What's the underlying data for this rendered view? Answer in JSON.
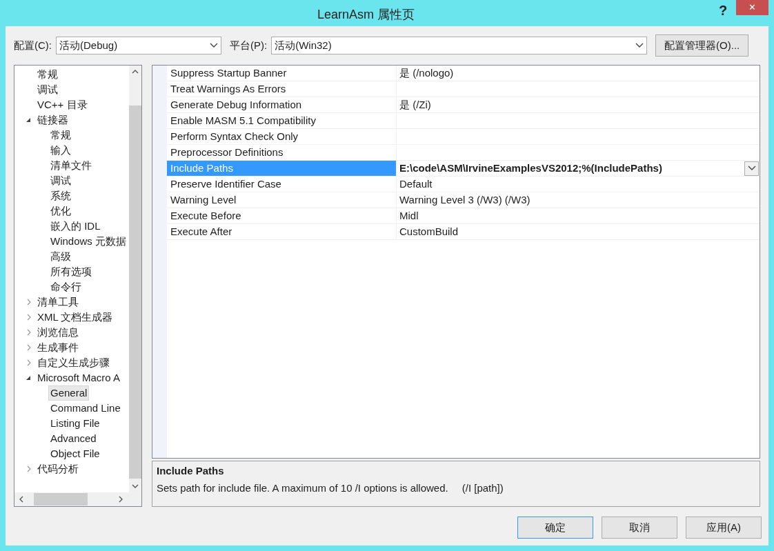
{
  "window": {
    "title": "LearnAsm 属性页",
    "help": "?",
    "close": "✕"
  },
  "toolbar": {
    "configuration": {
      "label": "配置(C):",
      "value": "活动(Debug)"
    },
    "platform": {
      "label": "平台(P):",
      "value": "活动(Win32)"
    },
    "manager_button": "配置管理器(O)..."
  },
  "tree": [
    {
      "label": "常规",
      "selected": false
    },
    {
      "label": "调试",
      "selected": false
    },
    {
      "label": "VC++ 目录",
      "selected": false
    },
    {
      "label": "链接器",
      "selected": false,
      "expanded": true,
      "children": [
        {
          "label": "常规",
          "selected": false
        },
        {
          "label": "输入",
          "selected": false
        },
        {
          "label": "清单文件",
          "selected": false
        },
        {
          "label": "调试",
          "selected": false
        },
        {
          "label": "系统",
          "selected": false
        },
        {
          "label": "优化",
          "selected": false
        },
        {
          "label": "嵌入的 IDL",
          "selected": false
        },
        {
          "label": "Windows 元数据",
          "selected": false
        },
        {
          "label": "高级",
          "selected": false
        },
        {
          "label": "所有选项",
          "selected": false
        },
        {
          "label": "命令行",
          "selected": false
        }
      ]
    },
    {
      "label": "清单工具",
      "selected": false,
      "expanded": false
    },
    {
      "label": "XML 文档生成器",
      "selected": false,
      "expanded": false
    },
    {
      "label": "浏览信息",
      "selected": false,
      "expanded": false
    },
    {
      "label": "生成事件",
      "selected": false,
      "expanded": false
    },
    {
      "label": "自定义生成步骤",
      "selected": false,
      "expanded": false
    },
    {
      "label": "Microsoft Macro A",
      "selected": false,
      "expanded": true,
      "children": [
        {
          "label": "General",
          "selected": true
        },
        {
          "label": "Command Line",
          "selected": false
        },
        {
          "label": "Listing File",
          "selected": false
        },
        {
          "label": "Advanced",
          "selected": false
        },
        {
          "label": "Object File",
          "selected": false
        }
      ]
    },
    {
      "label": "代码分析",
      "selected": false,
      "expanded": false
    }
  ],
  "properties": [
    {
      "name": "Suppress Startup Banner",
      "value": "是 (/nologo)",
      "selected": false
    },
    {
      "name": "Treat Warnings As Errors",
      "selected": false
    },
    {
      "name": "Generate Debug Information",
      "value": "是 (/Zi)",
      "selected": false
    },
    {
      "name": "Enable MASM 5.1 Compatibility",
      "selected": false
    },
    {
      "name": "Perform Syntax Check Only",
      "selected": false
    },
    {
      "name": "Preprocessor Definitions",
      "selected": false
    },
    {
      "name": "Include Paths",
      "value": "E:\\code\\ASM\\IrvineExamplesVS2012;%(IncludePaths)",
      "selected": true,
      "bold": true
    },
    {
      "name": "Preserve Identifier Case",
      "value": "Default",
      "selected": false
    },
    {
      "name": "Warning Level",
      "value": "Warning Level 3 (/W3) (/W3)",
      "selected": false
    },
    {
      "name": "Execute Before",
      "value": "Midl",
      "selected": false
    },
    {
      "name": "Execute After",
      "value": "CustomBuild",
      "selected": false
    }
  ],
  "description": {
    "title": "Include Paths",
    "text": "Sets path for include file. A maximum of 10 /I options is allowed.",
    "switch": "(/I [path])"
  },
  "buttons": [
    {
      "label": "确定",
      "default": true
    },
    {
      "label": "取消",
      "default": false
    },
    {
      "label": "应用(A)",
      "default": false
    }
  ]
}
